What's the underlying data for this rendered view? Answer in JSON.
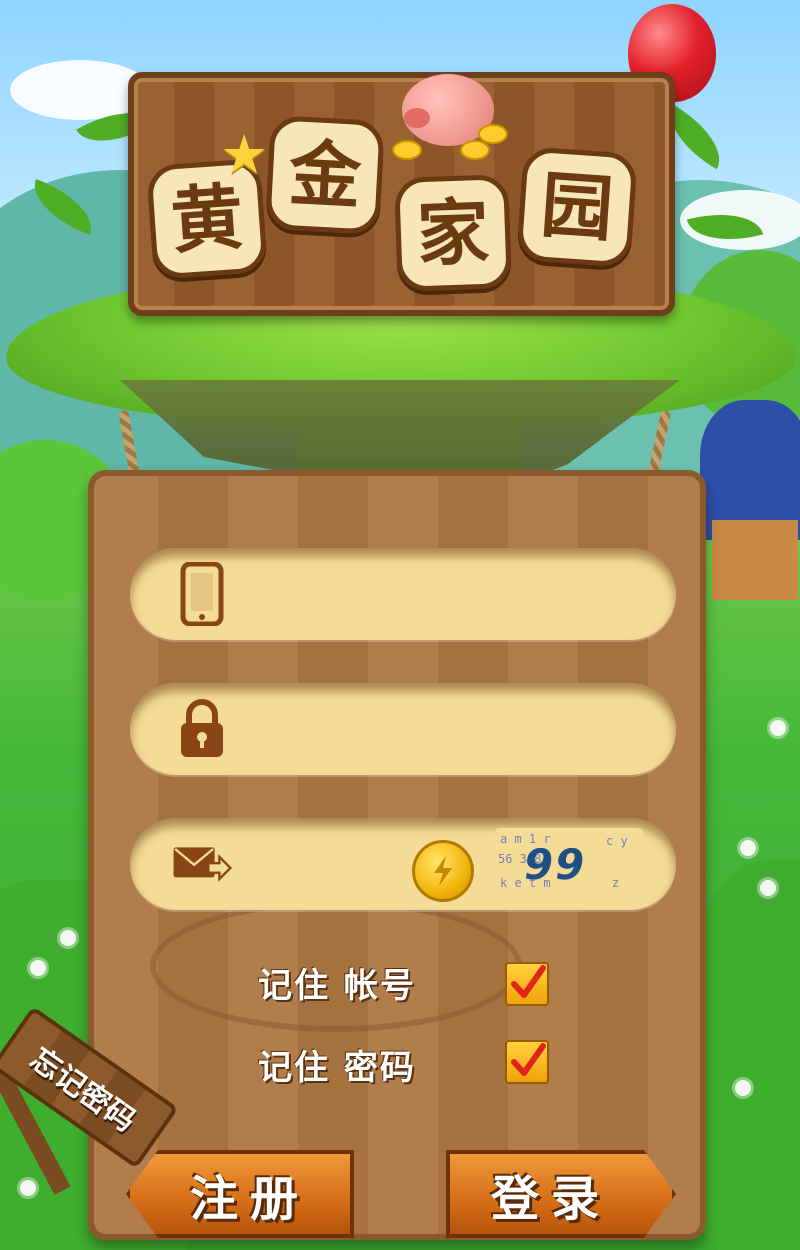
{
  "app": {
    "title_chars": [
      "黄",
      "金",
      "家",
      "园"
    ]
  },
  "login_form": {
    "phone": {
      "icon": "phone-icon",
      "value": "",
      "placeholder": ""
    },
    "password": {
      "icon": "lock-icon",
      "value": "",
      "placeholder": ""
    },
    "verification": {
      "icon": "envelope-send-icon",
      "value": "",
      "placeholder": "",
      "coin_icon": "gold-coin-icon",
      "captcha_text": "99"
    }
  },
  "options": {
    "remember_account": {
      "label": "记住 帐号",
      "checked": true
    },
    "remember_password": {
      "label": "记住 密码",
      "checked": true
    }
  },
  "links": {
    "forgot_password": "忘记密码"
  },
  "buttons": {
    "register": "注册",
    "login": "登录"
  },
  "colors": {
    "wood": "#a5713f",
    "field": "#f5dc96",
    "button": "#d8701a",
    "checkbox": "#f2a20a",
    "check_mark": "#e0241a"
  }
}
